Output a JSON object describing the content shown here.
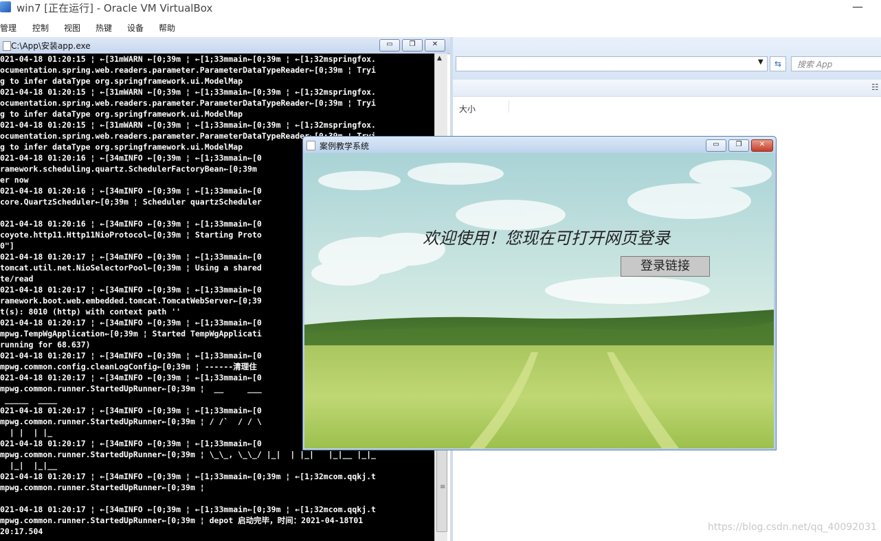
{
  "vbox": {
    "title": "win7 [正在运行] - Oracle VM VirtualBox",
    "close": "—",
    "menu": [
      "管理",
      "控制",
      "视图",
      "热键",
      "设备",
      "帮助"
    ]
  },
  "explorer": {
    "search_placeholder": "搜索 App",
    "column_size": "大小"
  },
  "console": {
    "title": "C:\\App\\安装app.exe",
    "lines": [
      "021-04-18 01:20:15 ¦ ←[31mWARN ←[0;39m ¦ ←[1;33mmain←[0;39m ¦ ←[1;32mspringfox.",
      "ocumentation.spring.web.readers.parameter.ParameterDataTypeReader←[0;39m ¦ Tryi",
      "g to infer dataType org.springframework.ui.ModelMap",
      "021-04-18 01:20:15 ¦ ←[31mWARN ←[0;39m ¦ ←[1;33mmain←[0;39m ¦ ←[1;32mspringfox.",
      "ocumentation.spring.web.readers.parameter.ParameterDataTypeReader←[0;39m ¦ Tryi",
      "g to infer dataType org.springframework.ui.ModelMap",
      "021-04-18 01:20:15 ¦ ←[31mWARN ←[0;39m ¦ ←[1;33mmain←[0;39m ¦ ←[1;32mspringfox.",
      "ocumentation.spring.web.readers.parameter.ParameterDataTypeReader←[0;39m ¦ Tryi",
      "g to infer dataType org.springframework.ui.ModelMap",
      "021-04-18 01:20:16 ¦ ←[34mINFO ←[0;39m ¦ ←[1;33mmain←[0",
      "ramework.scheduling.quartz.SchedulerFactoryBean←[0;39m",
      "er now",
      "021-04-18 01:20:16 ¦ ←[34mINFO ←[0;39m ¦ ←[1;33mmain←[0",
      "core.QuartzScheduler←[0;39m ¦ Scheduler quartzScheduler",
      "",
      "021-04-18 01:20:16 ¦ ←[34mINFO ←[0;39m ¦ ←[1;33mmain←[0",
      "coyote.http11.Http11NioProtocol←[0;39m ¦ Starting Proto",
      "0\"]",
      "021-04-18 01:20:17 ¦ ←[34mINFO ←[0;39m ¦ ←[1;33mmain←[0",
      "tomcat.util.net.NioSelectorPool←[0;39m ¦ Using a shared",
      "te/read",
      "021-04-18 01:20:17 ¦ ←[34mINFO ←[0;39m ¦ ←[1;33mmain←[0",
      "ramework.boot.web.embedded.tomcat.TomcatWebServer←[0;39",
      "t(s): 8010 (http) with context path ''",
      "021-04-18 01:20:17 ¦ ←[34mINFO ←[0;39m ¦ ←[1;33mmain←[0",
      "mpwg.TempWgApplication←[0;39m ¦ Started TempWgApplicati",
      "running for 68.637)",
      "021-04-18 01:20:17 ¦ ←[34mINFO ←[0;39m ¦ ←[1;33mmain←[0",
      "mpwg.common.config.cleanLogConfig←[0;39m ¦ ------清理住",
      "021-04-18 01:20:17 ¦ ←[34mINFO ←[0;39m ¦ ←[1;33mmain←[0",
      "mpwg.common.runner.StartedUpRunner←[0;39m ¦  __     ___",
      " _____  ____",
      "021-04-18 01:20:17 ¦ ←[34mINFO ←[0;39m ¦ ←[1;33mmain←[0",
      "mpwg.common.runner.StartedUpRunner←[0;39m ¦ / /`  / / \\",
      "  | |  | |_",
      "021-04-18 01:20:17 ¦ ←[34mINFO ←[0;39m ¦ ←[1;33mmain←[0",
      "mpwg.common.runner.StartedUpRunner←[0;39m ¦ \\_\\_, \\_\\_/ |_|  | |_|   |_|__ |_|_",
      "  |_|  |_|__",
      "021-04-18 01:20:17 ¦ ←[34mINFO ←[0;39m ¦ ←[1;33mmain←[0;39m ¦ ←[1;32mcom.qqkj.t",
      "mpwg.common.runner.StartedUpRunner←[0;39m ¦",
      "",
      "021-04-18 01:20:17 ¦ ←[34mINFO ←[0;39m ¦ ←[1;33mmain←[0;39m ¦ ←[1;32mcom.qqkj.t",
      "mpwg.common.runner.StartedUpRunner←[0;39m ¦ depot 启动完毕，时间：2021-04-18T01",
      "20:17.504"
    ]
  },
  "app": {
    "title": "案例教学系统",
    "welcome": "欢迎使用！您现在可打开网页登录",
    "login_button": "登录链接"
  },
  "watermark": "https://blog.csdn.net/qq_40092031"
}
